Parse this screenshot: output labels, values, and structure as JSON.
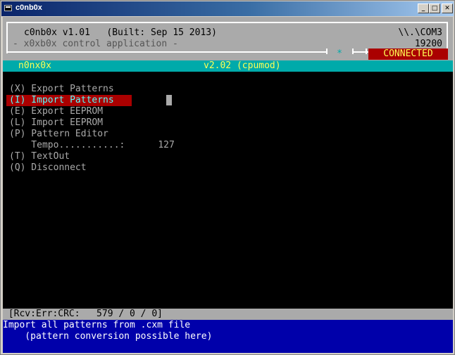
{
  "window": {
    "title": "c0nb0x",
    "buttons": {
      "minimize": "_",
      "maximize": "□",
      "close": "✕"
    }
  },
  "header": {
    "app_line": "c0nb0x v1.01   (Built: Sep 15 2013)",
    "subtitle": "- x0xb0x control application -",
    "port": "\\\\.\\COM3",
    "baud": "19200",
    "star": "*",
    "status": "CONNECTED",
    "status_color": "#aa0000"
  },
  "topbar": {
    "left": "n0nx0x",
    "right": "v2.02 (cpumod)",
    "color": "#00aaaa"
  },
  "menu": {
    "items": [
      {
        "key": "(X)",
        "label": "Export Patterns",
        "text": "(X) Export Patterns"
      },
      {
        "key": "(I)",
        "label": "Import Patterns",
        "text": "(I) Import Patterns",
        "selected": true
      },
      {
        "key": "(E)",
        "label": "Export EEPROM",
        "text": "(E) Export EEPROM"
      },
      {
        "key": "(L)",
        "label": "Import EEPROM",
        "text": "(L) Import EEPROM"
      },
      {
        "key": "(P)",
        "label": "Pattern Editor",
        "text": "(P) Pattern Editor"
      },
      {
        "key": "",
        "label": "Tempo",
        "text": "    Tempo...........:      127"
      },
      {
        "key": "(T)",
        "label": "TextOut",
        "text": "(T) TextOut"
      },
      {
        "key": "(Q)",
        "label": "Disconnect",
        "text": "(Q) Disconnect"
      }
    ],
    "highlight_color": "#aa0000"
  },
  "statusbar": {
    "text": " [Rcv:Err:CRC:   579 / 0 / 0]"
  },
  "help": {
    "line1": "Import all patterns from .cxm file",
    "line2": "    (pattern conversion possible here)",
    "color": "#0000aa"
  }
}
